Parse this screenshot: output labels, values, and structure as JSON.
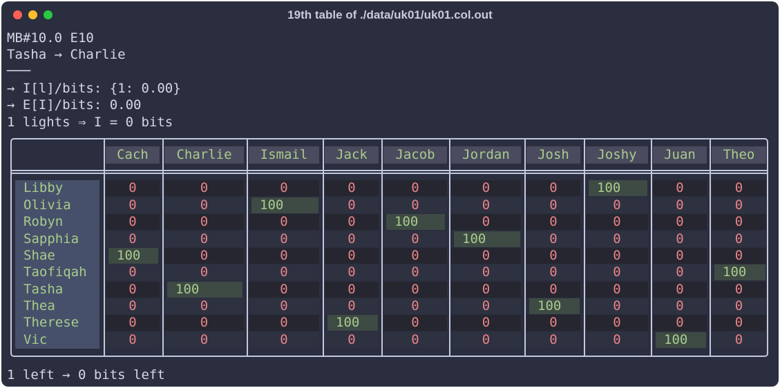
{
  "window": {
    "title": "19th table of ./data/uk01/uk01.col.out"
  },
  "header_lines": [
    "MB#10.0 E10",
    "Tasha → Charlie",
    "───",
    "→ I[l]/bits: {1: 0.00}",
    "→ E[I]/bits: 0.00",
    "1 lights ⇒ I = 0 bits"
  ],
  "table": {
    "columns": [
      "Cach",
      "Charlie",
      "Ismail",
      "Jack",
      "Jacob",
      "Jordan",
      "Josh",
      "Joshy",
      "Juan",
      "Theo"
    ],
    "rows": [
      {
        "name": "Libby",
        "values": [
          "0",
          "0",
          "0",
          "0",
          "0",
          "0",
          "0",
          "100",
          "0",
          "0"
        ]
      },
      {
        "name": "Olivia",
        "values": [
          "0",
          "0",
          "100",
          "0",
          "0",
          "0",
          "0",
          "0",
          "0",
          "0"
        ]
      },
      {
        "name": "Robyn",
        "values": [
          "0",
          "0",
          "0",
          "0",
          "100",
          "0",
          "0",
          "0",
          "0",
          "0"
        ]
      },
      {
        "name": "Sapphia",
        "values": [
          "0",
          "0",
          "0",
          "0",
          "0",
          "100",
          "0",
          "0",
          "0",
          "0"
        ]
      },
      {
        "name": "Shae",
        "values": [
          "100",
          "0",
          "0",
          "0",
          "0",
          "0",
          "0",
          "0",
          "0",
          "0"
        ]
      },
      {
        "name": "Taofiqah",
        "values": [
          "0",
          "0",
          "0",
          "0",
          "0",
          "0",
          "0",
          "0",
          "0",
          "100"
        ]
      },
      {
        "name": "Tasha",
        "values": [
          "0",
          "100",
          "0",
          "0",
          "0",
          "0",
          "0",
          "0",
          "0",
          "0"
        ]
      },
      {
        "name": "Thea",
        "values": [
          "0",
          "0",
          "0",
          "0",
          "0",
          "0",
          "100",
          "0",
          "0",
          "0"
        ]
      },
      {
        "name": "Therese",
        "values": [
          "0",
          "0",
          "0",
          "100",
          "0",
          "0",
          "0",
          "0",
          "0",
          "0"
        ]
      },
      {
        "name": "Vic",
        "values": [
          "0",
          "0",
          "0",
          "0",
          "0",
          "0",
          "0",
          "0",
          "100",
          "0"
        ]
      }
    ]
  },
  "footer_line": "1 left → 0 bits left",
  "colors": {
    "background": "#2b2e3e",
    "header_text": "#a8cc8c",
    "zero_value": "#e88388",
    "hit_value": "#a8cc8c",
    "border": "#c5c9dd"
  }
}
